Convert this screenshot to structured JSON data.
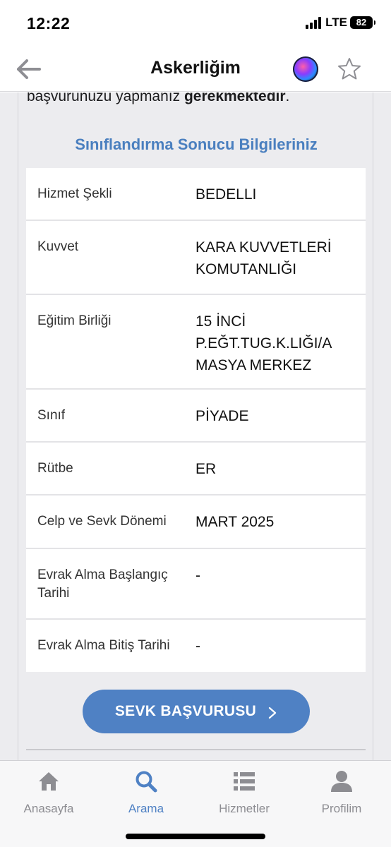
{
  "status_bar": {
    "time": "12:22",
    "network": "LTE",
    "battery": "82"
  },
  "nav": {
    "title": "Askerliğim",
    "back_icon": "arrow-left-icon",
    "siri_icon": "siri-icon",
    "favorite_icon": "star-icon"
  },
  "content": {
    "intro_prefix": "başvurunuzu yapmanız ",
    "intro_bold": "gerekmektedir",
    "intro_suffix": ".",
    "section_title": "Sınıflandırma Sonucu Bilgileriniz",
    "rows": [
      {
        "label": "Hizmet Şekli",
        "value": "BEDELLI"
      },
      {
        "label": "Kuvvet",
        "value": "KARA KUVVETLERİ KOMUTANLIĞI"
      },
      {
        "label": "Eğitim Birliği",
        "value": "15 İNCİ P.EĞT.TUG.K.LIĞI/A MASYA MERKEZ"
      },
      {
        "label": "Sınıf",
        "value": "PİYADE"
      },
      {
        "label": "Rütbe",
        "value": "ER"
      },
      {
        "label": "Celp ve Sevk Dönemi",
        "value": "MART 2025"
      },
      {
        "label": "Evrak Alma Başlangıç Tarihi",
        "value": "-"
      },
      {
        "label": "Evrak Alma Bitiş Tarihi",
        "value": "-"
      }
    ],
    "sevk_button": "SEVK BAŞVURUSU"
  },
  "tabs": [
    {
      "label": "Anasayfa",
      "icon": "home-icon",
      "active": false
    },
    {
      "label": "Arama",
      "icon": "search-icon",
      "active": true
    },
    {
      "label": "Hizmetler",
      "icon": "list-icon",
      "active": false
    },
    {
      "label": "Profilim",
      "icon": "person-icon",
      "active": false
    }
  ],
  "colors": {
    "accent": "#4f81c4",
    "background": "#ececef",
    "tab_inactive": "#8d8d92"
  }
}
